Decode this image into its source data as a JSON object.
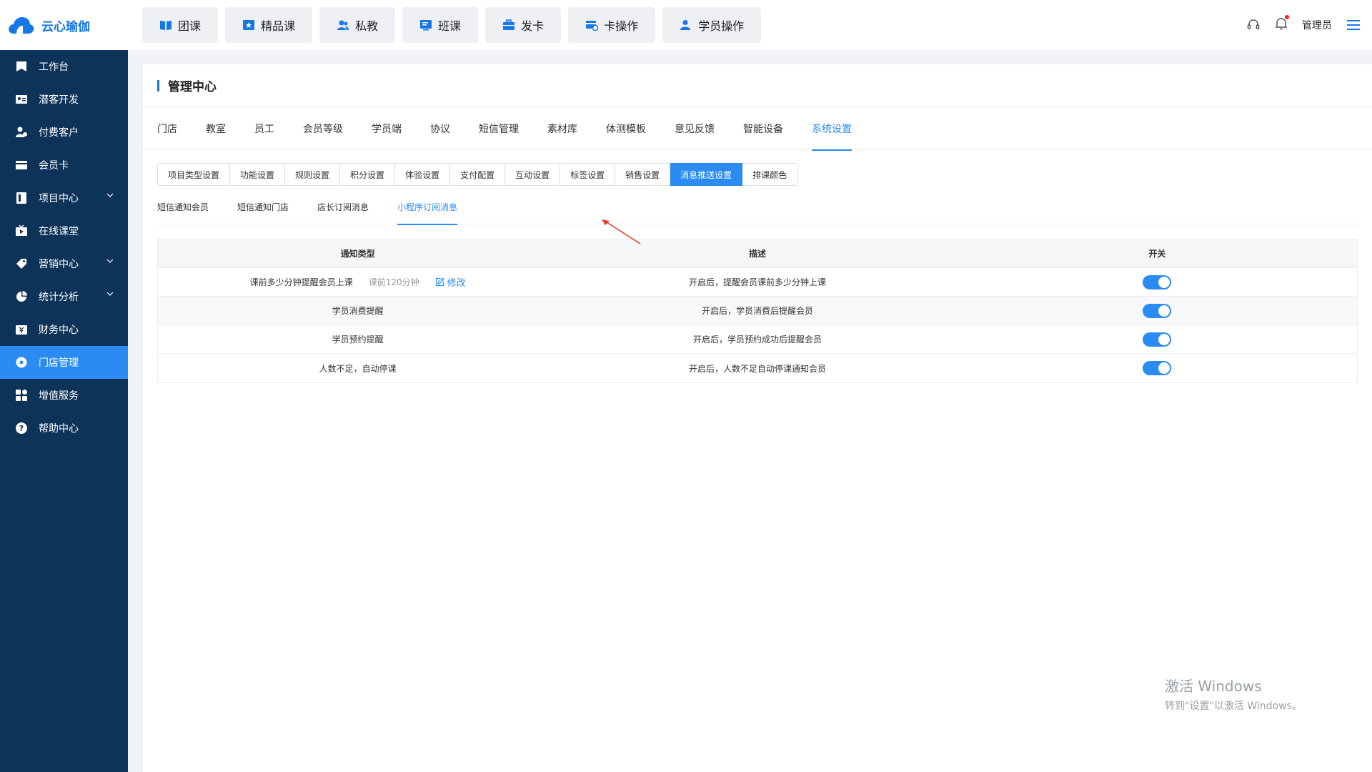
{
  "app": {
    "name": "云心瑜伽",
    "brand_color": "#1677e6",
    "accent_color": "#2a8bf2",
    "sidebar_color": "#0e3359"
  },
  "topnav": [
    {
      "label": "团课",
      "icon": "book-icon"
    },
    {
      "label": "精品课",
      "icon": "star-board-icon"
    },
    {
      "label": "私教",
      "icon": "users-icon"
    },
    {
      "label": "班课",
      "icon": "board-icon"
    },
    {
      "label": "发卡",
      "icon": "briefcase-icon"
    },
    {
      "label": "卡操作",
      "icon": "card-edit-icon"
    },
    {
      "label": "学员操作",
      "icon": "user-icon"
    }
  ],
  "header_right": {
    "user": "管理员"
  },
  "sidebar": [
    {
      "label": "工作台",
      "icon": "workbench-icon",
      "has_children": false,
      "active": false
    },
    {
      "label": "潜客开发",
      "icon": "id-card-icon",
      "has_children": false,
      "active": false
    },
    {
      "label": "付费客户",
      "icon": "customers-icon",
      "has_children": false,
      "active": false
    },
    {
      "label": "会员卡",
      "icon": "member-card-icon",
      "has_children": false,
      "active": false
    },
    {
      "label": "项目中心",
      "icon": "project-icon",
      "has_children": true,
      "active": false
    },
    {
      "label": "在线课堂",
      "icon": "tv-icon",
      "has_children": false,
      "active": false
    },
    {
      "label": "营销中心",
      "icon": "tag-icon",
      "has_children": true,
      "active": false
    },
    {
      "label": "统计分析",
      "icon": "pie-icon",
      "has_children": true,
      "active": false
    },
    {
      "label": "财务中心",
      "icon": "finance-icon",
      "has_children": false,
      "active": false
    },
    {
      "label": "门店管理",
      "icon": "store-icon",
      "has_children": false,
      "active": true
    },
    {
      "label": "增值服务",
      "icon": "apps-icon",
      "has_children": false,
      "active": false
    },
    {
      "label": "帮助中心",
      "icon": "help-icon",
      "has_children": false,
      "active": false
    }
  ],
  "panel": {
    "title": "管理中心"
  },
  "tabs1": [
    "门店",
    "教室",
    "员工",
    "会员等级",
    "学员端",
    "协议",
    "短信管理",
    "素材库",
    "体测模板",
    "意见反馈",
    "智能设备",
    "系统设置"
  ],
  "tabs1_active": 11,
  "segments": [
    "项目类型设置",
    "功能设置",
    "规则设置",
    "积分设置",
    "体验设置",
    "支付配置",
    "互动设置",
    "标签设置",
    "销售设置",
    "消息推送设置",
    "排课颜色"
  ],
  "segments_active": 9,
  "tabs2": [
    "短信通知会员",
    "短信通知门店",
    "店长订阅消息",
    "小程序订阅消息"
  ],
  "tabs2_active": 3,
  "table": {
    "headers": [
      "通知类型",
      "描述",
      "开关"
    ],
    "rows": [
      {
        "type": "课前多少分钟提醒会员上课",
        "hint": "课前120分钟",
        "edit": "修改",
        "desc": "开启后，提醒会员课前多少分钟上课",
        "on": true
      },
      {
        "type": "学员消费提醒",
        "hint": "",
        "edit": "",
        "desc": "开启后，学员消费后提醒会员",
        "on": true
      },
      {
        "type": "学员预约提醒",
        "hint": "",
        "edit": "",
        "desc": "开启后，学员预约成功后提醒会员",
        "on": true
      },
      {
        "type": "人数不足，自动停课",
        "hint": "",
        "edit": "",
        "desc": "开启后，人数不足自动停课通知会员",
        "on": true
      }
    ]
  },
  "watermark": {
    "line1": "激活 Windows",
    "line2": "转到\"设置\"以激活 Windows。"
  }
}
